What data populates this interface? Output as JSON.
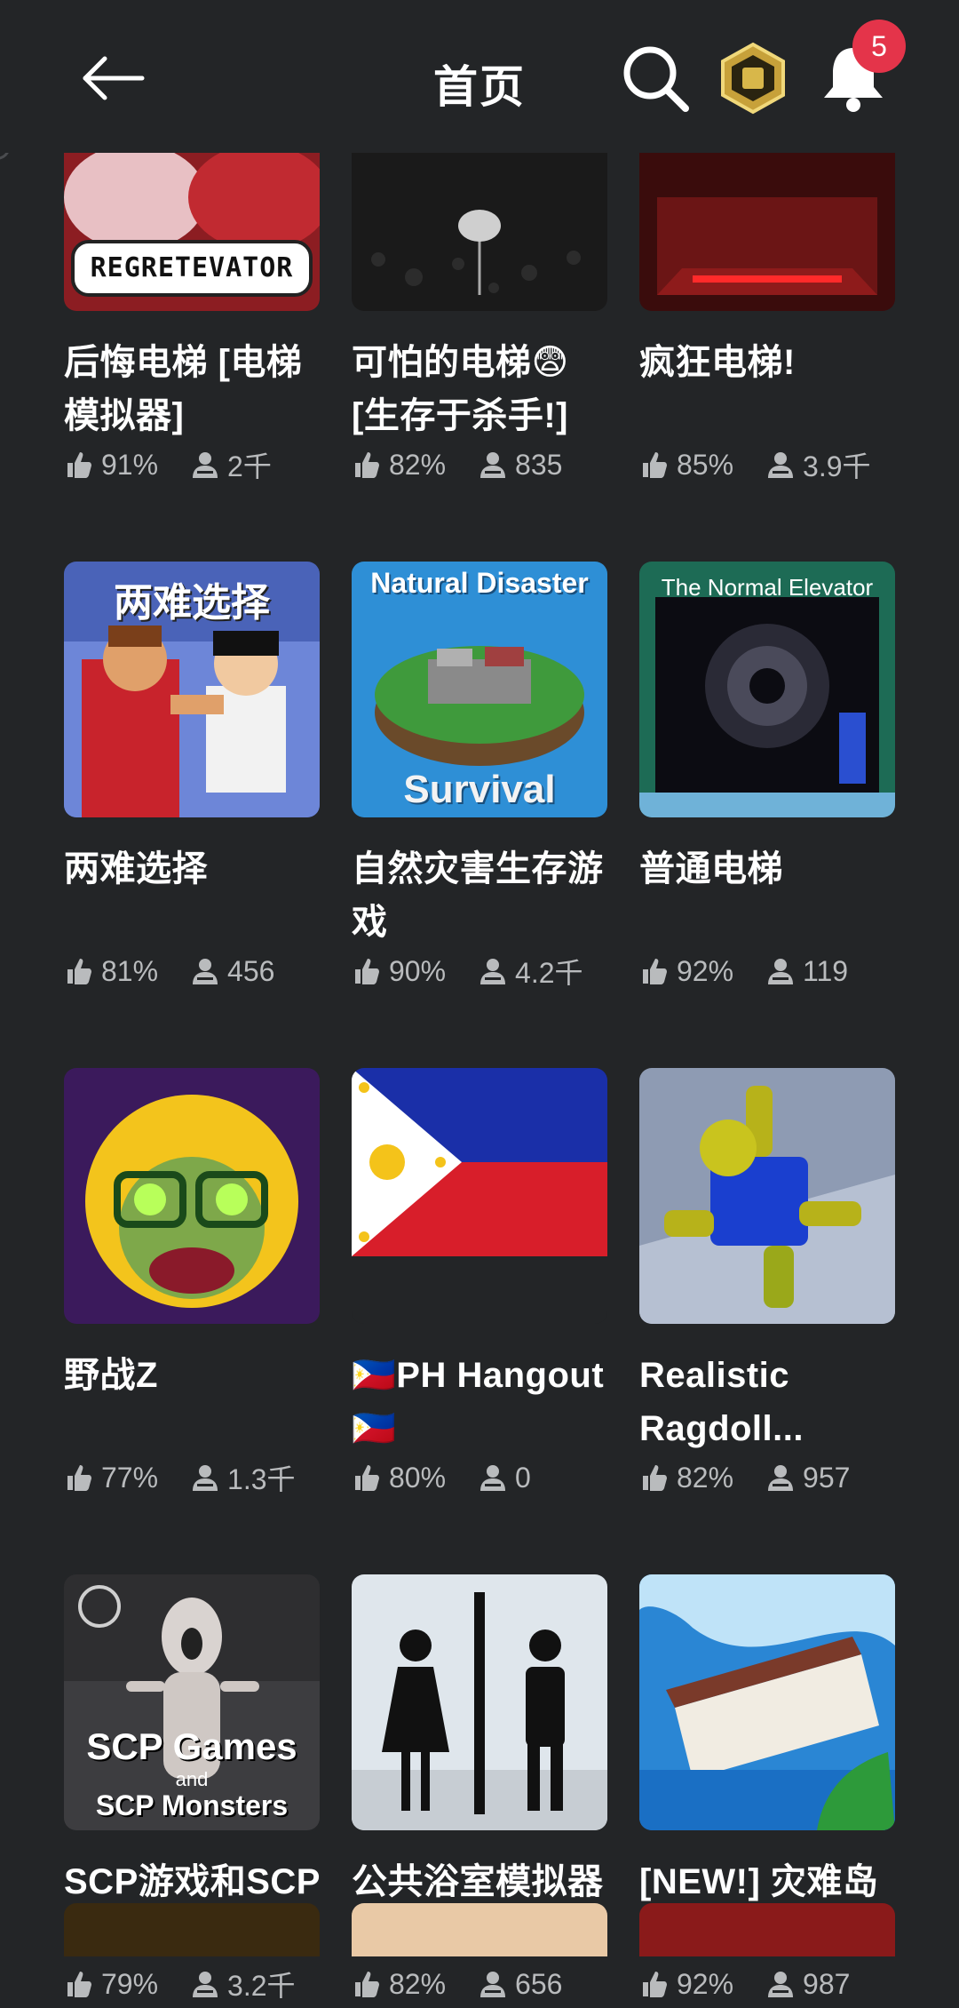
{
  "header": {
    "title": "首页",
    "notification_count": "5"
  },
  "stat_icons": {
    "rating": "thumbs-up-icon",
    "players": "player-count-icon"
  },
  "games": [
    {
      "title": "后悔电梯 [电梯模拟器]",
      "rating": "91%",
      "players": "2千",
      "thumb_text": "REGRETEVATOR"
    },
    {
      "title": "可怕的电梯😨[生存于杀手!]",
      "rating": "82%",
      "players": "835"
    },
    {
      "title": "疯狂电梯!",
      "rating": "85%",
      "players": "3.9千"
    },
    {
      "title": "两难选择",
      "rating": "81%",
      "players": "456",
      "thumb_text": "两难选择"
    },
    {
      "title": "自然灾害生存游戏",
      "rating": "90%",
      "players": "4.2千",
      "thumb_text_top": "Natural Disaster",
      "thumb_text_bottom": "Survival"
    },
    {
      "title": "普通电梯",
      "rating": "92%",
      "players": "119",
      "thumb_text": "The Normal Elevator"
    },
    {
      "title": "野战Z",
      "rating": "77%",
      "players": "1.3千"
    },
    {
      "title": "🇵🇭PH Hangout🇵🇭",
      "rating": "80%",
      "players": "0"
    },
    {
      "title": "Realistic Ragdoll...",
      "rating": "82%",
      "players": "957"
    },
    {
      "title": "SCP游戏和SCP怪物",
      "rating": "79%",
      "players": "3.2千",
      "thumb_text_1": "SCP Games",
      "thumb_text_2": "and",
      "thumb_text_3": "SCP Monsters"
    },
    {
      "title": "公共浴室模拟器",
      "rating": "82%",
      "players": "656"
    },
    {
      "title": "[NEW!] 灾难岛🏝️生存",
      "rating": "92%",
      "players": "987"
    }
  ],
  "colors": {
    "background": "#232527",
    "text": "#ffffff",
    "muted": "#b9bbbd",
    "badge": "#e4344a"
  }
}
